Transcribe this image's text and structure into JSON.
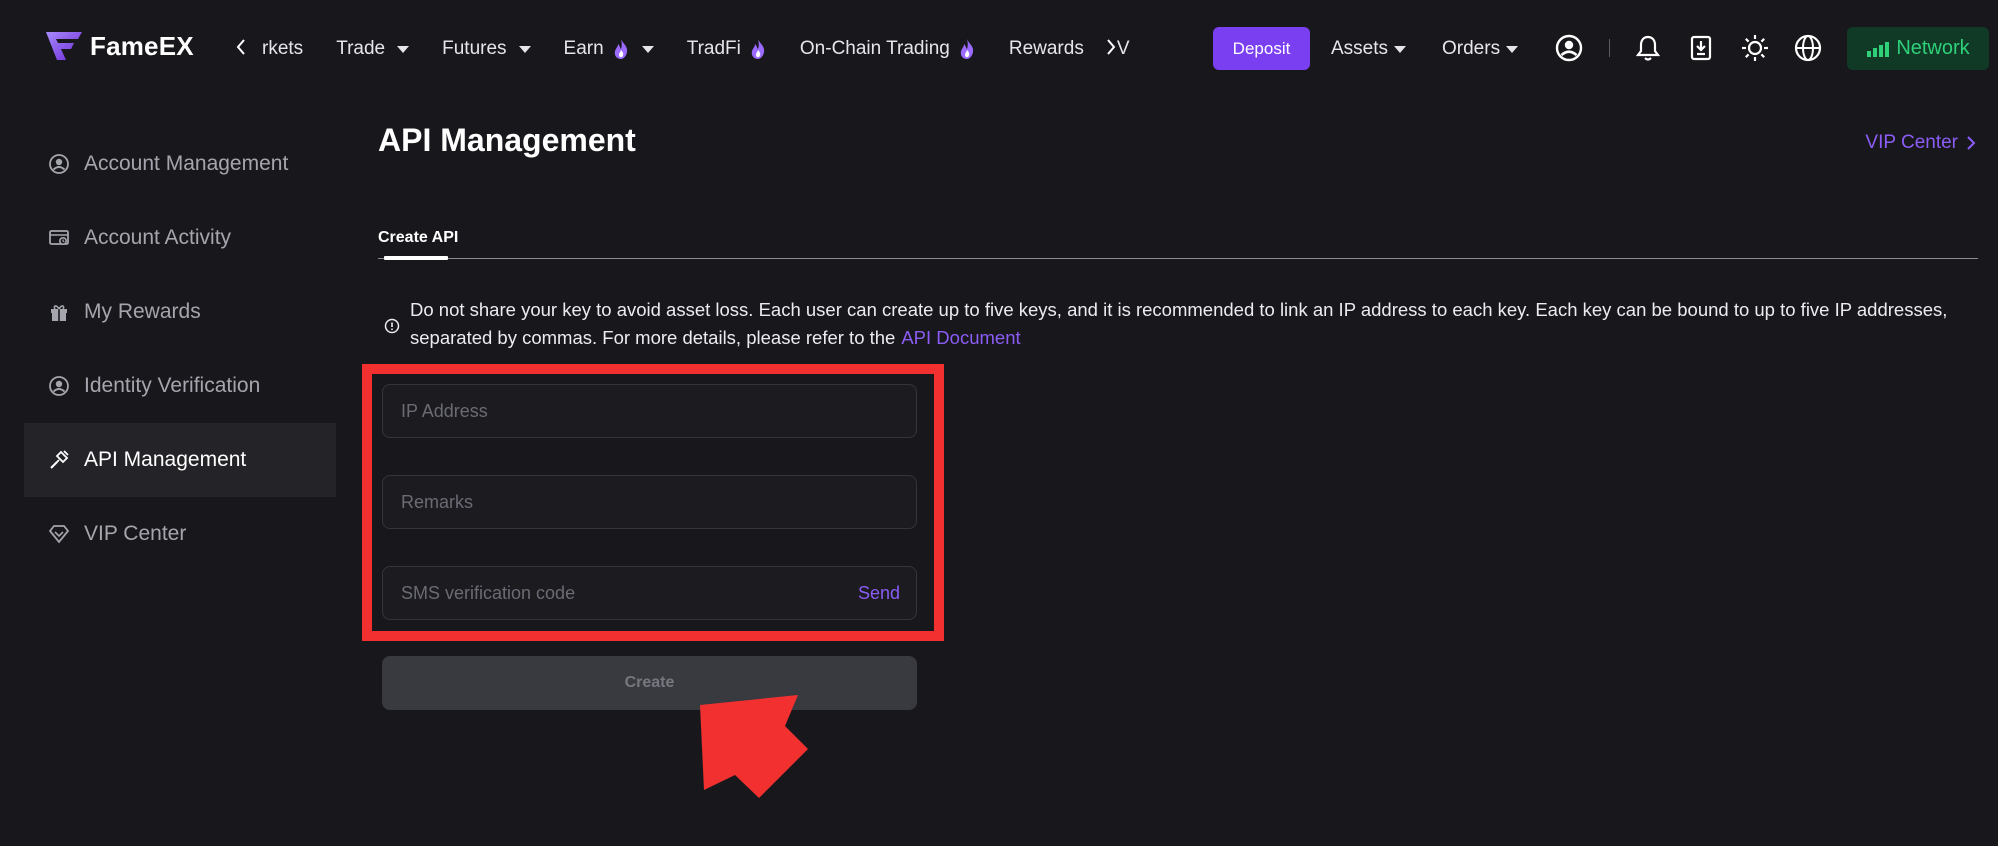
{
  "brand": {
    "name": "FameEX"
  },
  "nav": {
    "items": [
      {
        "label": "rkets",
        "caret": false,
        "flame": false
      },
      {
        "label": "Trade",
        "caret": true,
        "flame": false
      },
      {
        "label": "Futures",
        "caret": true,
        "flame": false
      },
      {
        "label": "Earn",
        "caret": true,
        "flame": true
      },
      {
        "label": "TradFi",
        "caret": false,
        "flame": true
      },
      {
        "label": "On-Chain Trading",
        "caret": false,
        "flame": true
      },
      {
        "label": "Rewards",
        "caret": false,
        "flame": false
      },
      {
        "label": "V",
        "caret": false,
        "flame": false
      }
    ],
    "deposit_label": "Deposit",
    "assets_label": "Assets",
    "orders_label": "Orders",
    "network_label": "Network"
  },
  "sidebar": {
    "items": [
      {
        "label": "Account Management",
        "icon": "user-circle-icon",
        "active": false
      },
      {
        "label": "Account Activity",
        "icon": "activity-icon",
        "active": false
      },
      {
        "label": "My Rewards",
        "icon": "gift-icon",
        "active": false
      },
      {
        "label": "Identity Verification",
        "icon": "id-verify-icon",
        "active": false
      },
      {
        "label": "API Management",
        "icon": "api-plug-icon",
        "active": true
      },
      {
        "label": "VIP Center",
        "icon": "diamond-icon",
        "active": false
      }
    ]
  },
  "main": {
    "title": "API Management",
    "vip_link": "VIP Center",
    "tab_label": "Create API",
    "notice_text": "Do not share your key to avoid asset loss. Each user can create up to five keys, and it is recommended to link an IP address to each key. Each key can be bound to up to five IP addresses, separated by commas. For more details, please refer to the",
    "notice_link": "API Document"
  },
  "form": {
    "ip_placeholder": "IP Address",
    "ip_value": "",
    "remarks_placeholder": "Remarks",
    "remarks_value": "",
    "sms_placeholder": "SMS verification code",
    "sms_value": "",
    "send_label": "Send",
    "create_label": "Create"
  },
  "colors": {
    "accent": "#7b3ff2",
    "link": "#8b5cf6",
    "network": "#2fd07a",
    "highlight": "#f23030"
  }
}
